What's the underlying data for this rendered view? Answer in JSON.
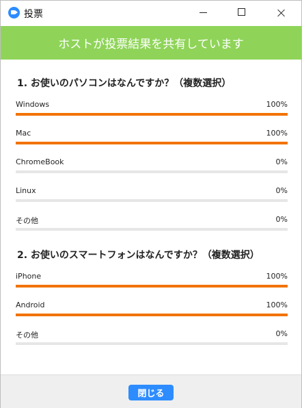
{
  "window": {
    "title": "投票"
  },
  "banner": {
    "text": "ホストが投票結果を共有しています"
  },
  "questions": [
    {
      "title": "1. お使いのパソコンはなんですか？（複数選択）",
      "options": [
        {
          "label": "Windows",
          "percent_text": "100%",
          "percent": 100
        },
        {
          "label": "Mac",
          "percent_text": "100%",
          "percent": 100
        },
        {
          "label": "ChromeBook",
          "percent_text": "0%",
          "percent": 0
        },
        {
          "label": "Linux",
          "percent_text": "0%",
          "percent": 0
        },
        {
          "label": "その他",
          "percent_text": "0%",
          "percent": 0
        }
      ]
    },
    {
      "title": "2. お使いのスマートフォンはなんですか？（複数選択）",
      "options": [
        {
          "label": "iPhone",
          "percent_text": "100%",
          "percent": 100
        },
        {
          "label": "Android",
          "percent_text": "100%",
          "percent": 100
        },
        {
          "label": "その他",
          "percent_text": "0%",
          "percent": 0
        }
      ]
    }
  ],
  "footer": {
    "close_label": "閉じる"
  },
  "colors": {
    "banner": "#8fd459",
    "bar_fill": "#f27300",
    "bar_track": "#e6e6e6",
    "button": "#2d8cff"
  },
  "icons": {
    "app": "zoom-camera-icon"
  }
}
